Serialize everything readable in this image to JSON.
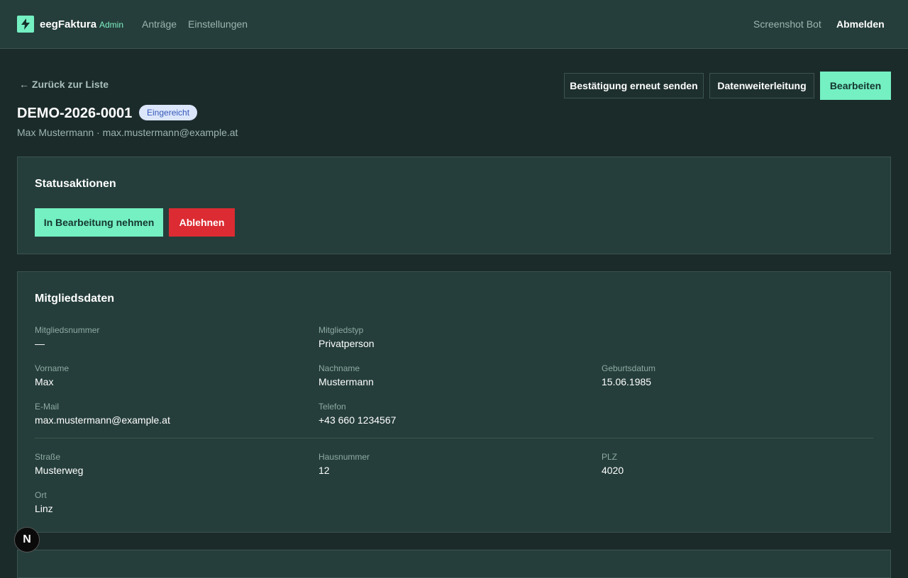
{
  "header": {
    "brand": "eegFaktura",
    "brand_tag": "Admin",
    "nav": [
      "Anträge",
      "Einstellungen"
    ],
    "user": "Screenshot Bot",
    "logout": "Abmelden"
  },
  "toolbar": {
    "back": "← Zurück zur Liste",
    "resend": "Bestätigung erneut senden",
    "forward": "Datenweiterleitung",
    "edit": "Bearbeiten"
  },
  "application": {
    "id": "DEMO-2026-0001",
    "status": "Eingereicht",
    "subline": "Max Mustermann · max.mustermann@example.at"
  },
  "status_actions": {
    "title": "Statusaktionen",
    "take": "In Bearbeitung nehmen",
    "reject": "Ablehnen"
  },
  "member": {
    "title": "Mitgliedsdaten",
    "fields": [
      {
        "label": "Mitgliedsnummer",
        "value": "—"
      },
      {
        "label": "Mitgliedstyp",
        "value": "Privatperson"
      },
      {
        "label": "Vorname",
        "value": "Max"
      },
      {
        "label": "Nachname",
        "value": "Mustermann"
      },
      {
        "label": "Geburtsdatum",
        "value": "15.06.1985"
      },
      {
        "label": "E-Mail",
        "value": "max.mustermann@example.at"
      },
      {
        "label": "Telefon",
        "value": "+43 660 1234567"
      },
      {
        "label": "Straße",
        "value": "Musterweg"
      },
      {
        "label": "Hausnummer",
        "value": "12"
      },
      {
        "label": "PLZ",
        "value": "4020"
      },
      {
        "label": "Ort",
        "value": "Linz"
      }
    ]
  },
  "fab": {
    "label": "N"
  },
  "colors": {
    "accent": "#74f0c2",
    "danger": "#dc2b32",
    "background": "#1b2b2a",
    "panel": "#253e3b"
  }
}
